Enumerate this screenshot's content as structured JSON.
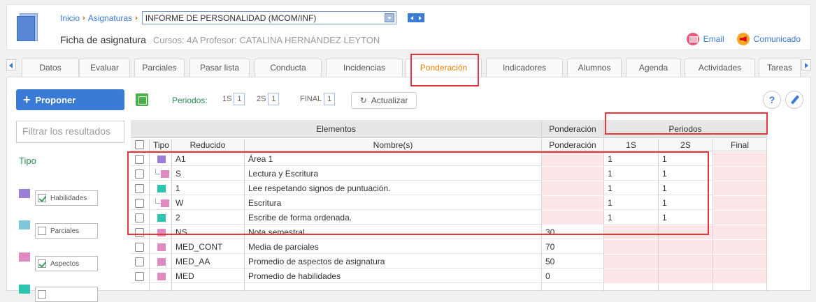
{
  "breadcrumb": {
    "home": "Inicio",
    "section": "Asignaturas",
    "subject": "INFORME DE PERSONALIDAD (MCOM/INF)"
  },
  "header": {
    "title": "Ficha de asignatura",
    "subtitle": "Cursos: 4A Profesor: CATALINA HERNÁNDEZ LEYTON",
    "email_label": "Email",
    "comunicado_label": "Comunicado"
  },
  "tabs": [
    "Datos",
    "Evaluar",
    "Parciales",
    "Pasar lista",
    "Conducta",
    "Incidencias",
    "Ponderación",
    "Indicadores",
    "Alumnos",
    "Agenda",
    "Actividades",
    "Tareas"
  ],
  "active_tab": "Ponderación",
  "toolbar": {
    "propose_label": "Proponer",
    "periods_label": "Periodos:",
    "periods": [
      {
        "label": "1S",
        "value": "1"
      },
      {
        "label": "2S",
        "value": "1"
      },
      {
        "label": "FINAL",
        "value": "1"
      }
    ],
    "refresh_label": "Actualizar",
    "help_label": "?"
  },
  "filter": {
    "placeholder": "Filtrar los resultados",
    "tipo_label": "Tipo",
    "types": [
      {
        "label": "Habilidades",
        "checked": true,
        "color": "#9b7fd4"
      },
      {
        "label": "Parciales",
        "checked": false,
        "color": "#7fc6d9"
      },
      {
        "label": "Aspectos",
        "checked": true,
        "color": "#e08ac2"
      },
      {
        "label": "",
        "checked": false,
        "color": "#2cc5b0"
      }
    ]
  },
  "table": {
    "group_headers": {
      "elementos": "Elementos",
      "ponderacion": "Ponderación",
      "periodos": "Periodos"
    },
    "columns": {
      "tipo": "Tipo",
      "reducido": "Reducido",
      "nombre": "Nombre(s)",
      "ponderacion": "Ponderación",
      "p1": "1S",
      "p2": "2S",
      "final": "Final"
    },
    "rows": [
      {
        "color": "#9b7fd4",
        "child": false,
        "reducido": "A1",
        "nombre": "Área 1",
        "ponderacion": "",
        "p1": "1",
        "p2": "1",
        "final": ""
      },
      {
        "color": "#e08ac2",
        "child": true,
        "reducido": "S",
        "nombre": "Lectura y Escritura",
        "ponderacion": "",
        "p1": "1",
        "p2": "1",
        "final": ""
      },
      {
        "color": "#2cc5b0",
        "child": false,
        "reducido": "1",
        "nombre": "Lee respetando signos de puntuación.",
        "ponderacion": "",
        "p1": "1",
        "p2": "1",
        "final": ""
      },
      {
        "color": "#e08ac2",
        "child": true,
        "reducido": "W",
        "nombre": "Escritura",
        "ponderacion": "",
        "p1": "1",
        "p2": "1",
        "final": ""
      },
      {
        "color": "#2cc5b0",
        "child": false,
        "reducido": "2",
        "nombre": "Escribe de forma ordenada.",
        "ponderacion": "",
        "p1": "1",
        "p2": "1",
        "final": ""
      },
      {
        "color": "#e08ac2",
        "child": false,
        "reducido": "NS",
        "nombre": "Nota semestral",
        "ponderacion": "30",
        "p1": "",
        "p2": "",
        "final": ""
      },
      {
        "color": "#e08ac2",
        "child": false,
        "reducido": "MED_CONT",
        "nombre": "Media de parciales",
        "ponderacion": "70",
        "p1": "",
        "p2": "",
        "final": ""
      },
      {
        "color": "#e08ac2",
        "child": false,
        "reducido": "MED_AA",
        "nombre": "Promedio de aspectos de asignatura",
        "ponderacion": "50",
        "p1": "",
        "p2": "",
        "final": ""
      },
      {
        "color": "#e08ac2",
        "child": false,
        "reducido": "MED",
        "nombre": "Promedio de habilidades",
        "ponderacion": "0",
        "p1": "",
        "p2": "",
        "final": ""
      }
    ]
  }
}
